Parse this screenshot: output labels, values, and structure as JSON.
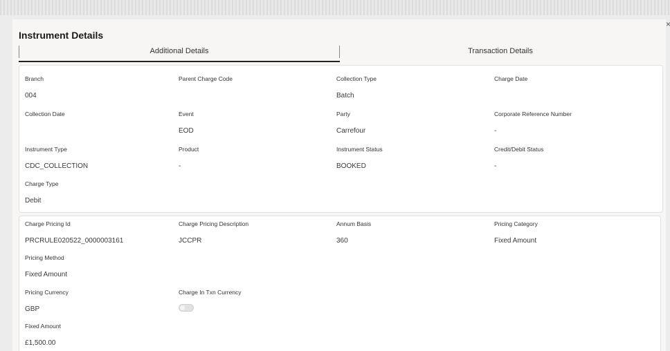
{
  "page": {
    "title": "Instrument Details",
    "close_icon": "close-icon"
  },
  "tabs": [
    {
      "label": "Additional Details",
      "active": true
    },
    {
      "label": "Transaction Details",
      "active": false
    }
  ],
  "instrument": {
    "branch": {
      "label": "Branch",
      "value": "004"
    },
    "parent_charge_code": {
      "label": "Parent Charge Code",
      "value": ""
    },
    "collection_type": {
      "label": "Collection Type",
      "value": "Batch"
    },
    "charge_date": {
      "label": "Charge Date",
      "value": ""
    },
    "collection_date": {
      "label": "Collection Date",
      "value": ""
    },
    "event": {
      "label": "Event",
      "value": "EOD"
    },
    "party": {
      "label": "Party",
      "value": "Carrefour"
    },
    "corporate_reference_number": {
      "label": "Corporate Reference Number",
      "value": "-"
    },
    "instrument_type": {
      "label": "Instrument Type",
      "value": "CDC_COLLECTION"
    },
    "product": {
      "label": "Product",
      "value": "-"
    },
    "instrument_status": {
      "label": "Instrument Status",
      "value": "BOOKED"
    },
    "credit_debit_status": {
      "label": "Credit/Debit Status",
      "value": "-"
    },
    "charge_type": {
      "label": "Charge Type",
      "value": "Debit"
    }
  },
  "pricing": {
    "charge_pricing_id": {
      "label": "Charge Pricing Id",
      "value": "PRCRULE020522_0000003161"
    },
    "charge_pricing_description": {
      "label": "Charge Pricing Description",
      "value": "JCCPR"
    },
    "annum_basis": {
      "label": "Annum Basis",
      "value": "360"
    },
    "pricing_category": {
      "label": "Pricing Category",
      "value": "Fixed Amount"
    },
    "pricing_method": {
      "label": "Pricing Method",
      "value": "Fixed Amount"
    },
    "pricing_currency": {
      "label": "Pricing Currency",
      "value": "GBP"
    },
    "charge_in_txn_currency": {
      "label": "Charge In Txn Currency",
      "checked": false
    },
    "fixed_amount": {
      "label": "Fixed Amount",
      "value": "£1,500.00"
    }
  }
}
